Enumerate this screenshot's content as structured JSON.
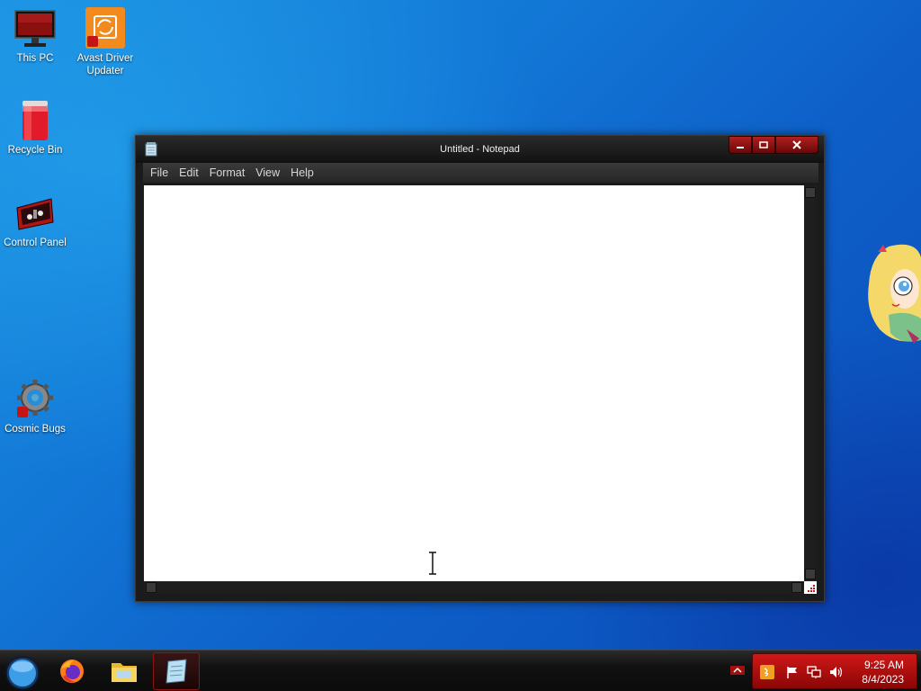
{
  "desktop": {
    "icons": [
      {
        "label": "This PC",
        "icon": "monitor-icon"
      },
      {
        "label": "Avast Driver Updater",
        "icon": "avast-driver-updater-icon"
      },
      {
        "label": "Recycle Bin",
        "icon": "recycle-bin-icon"
      },
      {
        "label": "Control Panel",
        "icon": "control-panel-icon"
      },
      {
        "label": "Cosmic Bugs",
        "icon": "cosmic-bugs-icon"
      }
    ]
  },
  "window": {
    "title": "Untitled - Notepad",
    "menu": [
      "File",
      "Edit",
      "Format",
      "View",
      "Help"
    ],
    "content": ""
  },
  "taskbar": {
    "apps": [
      {
        "name": "Firefox",
        "icon": "firefox-icon"
      },
      {
        "name": "File Explorer",
        "icon": "folder-icon"
      },
      {
        "name": "Notepad",
        "icon": "notepad-icon",
        "active": true
      }
    ],
    "clock": {
      "time": "9:25 AM",
      "date": "8/4/2023"
    }
  },
  "colors": {
    "accent": "#c41414",
    "desktop": "#1277d6"
  }
}
